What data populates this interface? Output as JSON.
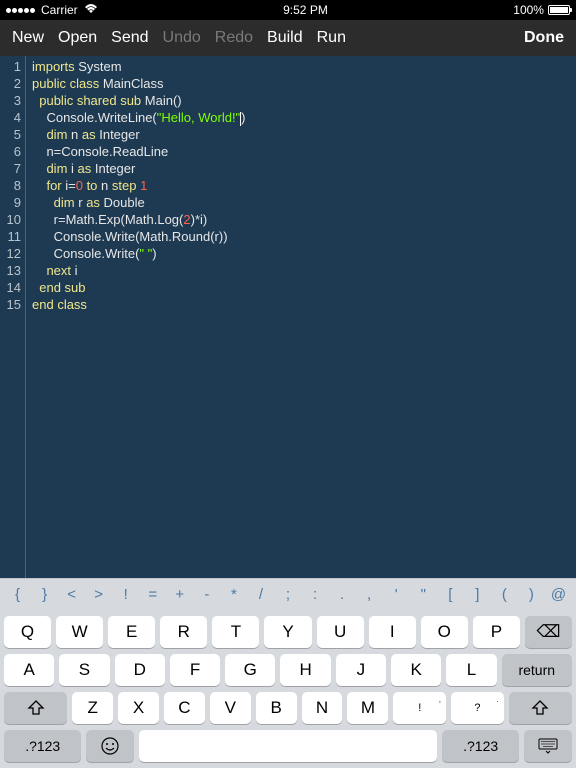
{
  "statusbar": {
    "carrier": "Carrier",
    "time": "9:52 PM",
    "battery": "100%"
  },
  "toolbar": {
    "new": "New",
    "open": "Open",
    "send": "Send",
    "undo": "Undo",
    "redo": "Redo",
    "build": "Build",
    "run": "Run",
    "done": "Done"
  },
  "lines": [
    "1",
    "2",
    "3",
    "4",
    "5",
    "6",
    "7",
    "8",
    "9",
    "10",
    "11",
    "12",
    "13",
    "14",
    "15"
  ],
  "code": {
    "l1": {
      "a": "imports",
      "b": " System"
    },
    "l2": {
      "a": "public",
      "b": " class",
      "c": " MainClass"
    },
    "l3": {
      "a": "public",
      "b": " shared",
      "c": " sub",
      "d": " Main()"
    },
    "l4": {
      "a": "Console.WriteLine(",
      "b": "\"Hello, World!\"",
      "c": ")"
    },
    "l5": {
      "a": "dim",
      "b": " n ",
      "c": "as",
      "d": " Integer"
    },
    "l6": {
      "a": "n=Console.ReadLine"
    },
    "l7": {
      "a": "dim",
      "b": " i ",
      "c": "as",
      "d": " Integer"
    },
    "l8": {
      "a": "for",
      "b": " i=",
      "c": "0",
      "d": " to",
      "e": " n ",
      "f": "step",
      "g": " 1"
    },
    "l9": {
      "a": "dim",
      "b": " r ",
      "c": "as",
      "d": " Double"
    },
    "l10": {
      "a": "r=Math.Exp(Math.Log(",
      "b": "2",
      "c": ")*i)"
    },
    "l11": {
      "a": "Console.Write(Math.Round(r))"
    },
    "l12": {
      "a": "Console.Write(",
      "b": "\" \"",
      "c": ")"
    },
    "l13": {
      "a": "next",
      "b": " i"
    },
    "l14": {
      "a": "end",
      "b": " sub"
    },
    "l15": {
      "a": "end",
      "b": " class"
    }
  },
  "symbols": [
    "{",
    "}",
    "<",
    ">",
    "!",
    "=",
    "+",
    "-",
    "*",
    "/",
    ";",
    ":",
    ".",
    ",",
    "'",
    "\"",
    "[",
    "]",
    "(",
    ")",
    "@"
  ],
  "keys": {
    "row1": [
      "Q",
      "W",
      "E",
      "R",
      "T",
      "Y",
      "U",
      "I",
      "O",
      "P"
    ],
    "row2": [
      "A",
      "S",
      "D",
      "F",
      "G",
      "H",
      "J",
      "K",
      "L"
    ],
    "row3": [
      "Z",
      "X",
      "C",
      "V",
      "B",
      "N",
      "M"
    ],
    "punct1": {
      "main": "!",
      "sub": ","
    },
    "punct2": {
      "main": "?",
      "sub": "."
    },
    "backspace": "⌫",
    "shift": "⇧",
    "numkey": ".?123",
    "emoji": "😀",
    "hide": "⌨",
    "return": "return"
  }
}
